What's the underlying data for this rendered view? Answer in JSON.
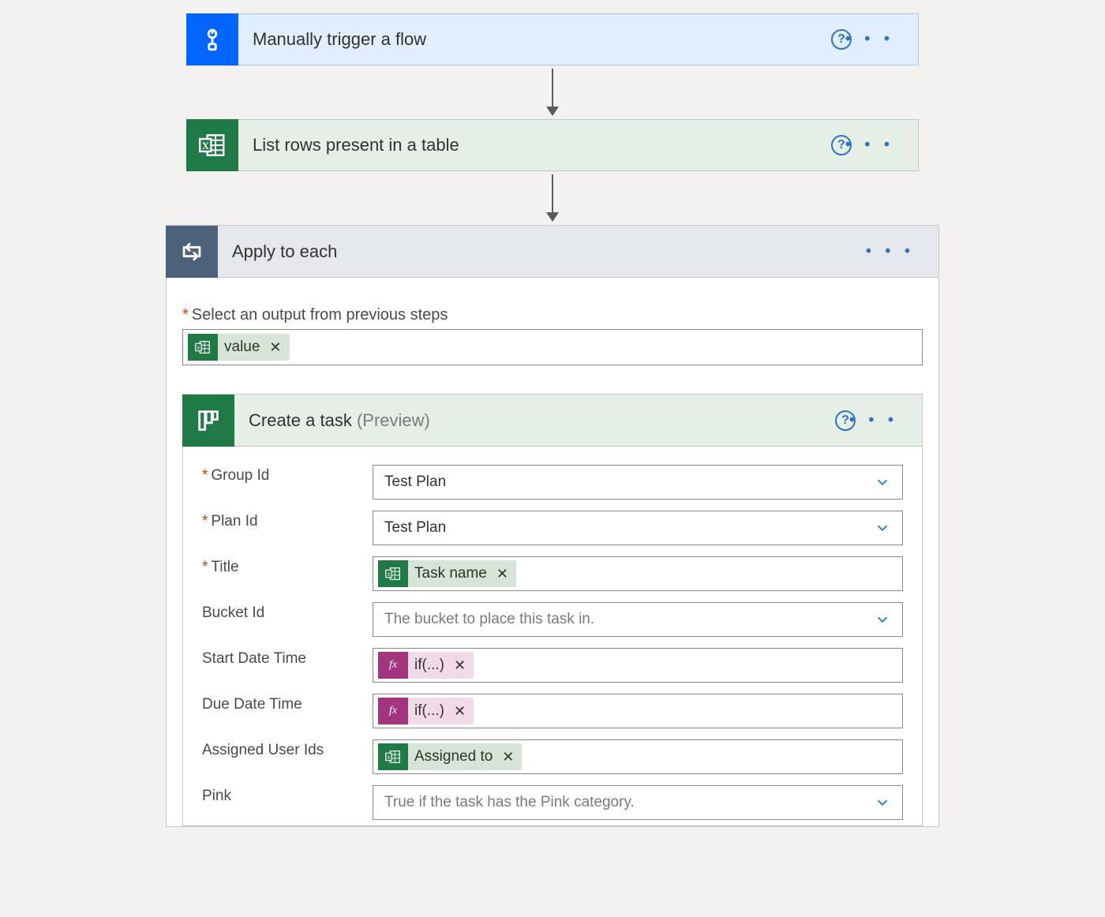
{
  "steps": {
    "trigger": {
      "title": "Manually trigger a flow"
    },
    "listRows": {
      "title": "List rows present in a table"
    },
    "applyEach": {
      "title": "Apply to each",
      "selectOutputLabel": "Select an output from previous steps",
      "outputToken": "value"
    },
    "createTask": {
      "title": "Create a task ",
      "suffix": "(Preview)",
      "fields": {
        "groupId": {
          "label": "Group Id",
          "value": "Test Plan"
        },
        "planId": {
          "label": "Plan Id",
          "value": "Test Plan"
        },
        "title": {
          "label": "Title",
          "token": "Task name"
        },
        "bucket": {
          "label": "Bucket Id",
          "placeholder": "The bucket to place this task in."
        },
        "start": {
          "label": "Start Date Time",
          "expr": "if(...)"
        },
        "due": {
          "label": "Due Date Time",
          "expr": "if(...)"
        },
        "assigned": {
          "label": "Assigned User Ids",
          "token": "Assigned to"
        },
        "pink": {
          "label": "Pink",
          "placeholder": "True if the task has the Pink category."
        }
      }
    }
  },
  "glyphs": {
    "fx": "fx",
    "close": "✕",
    "dots": "•  •  •",
    "help": "?"
  }
}
